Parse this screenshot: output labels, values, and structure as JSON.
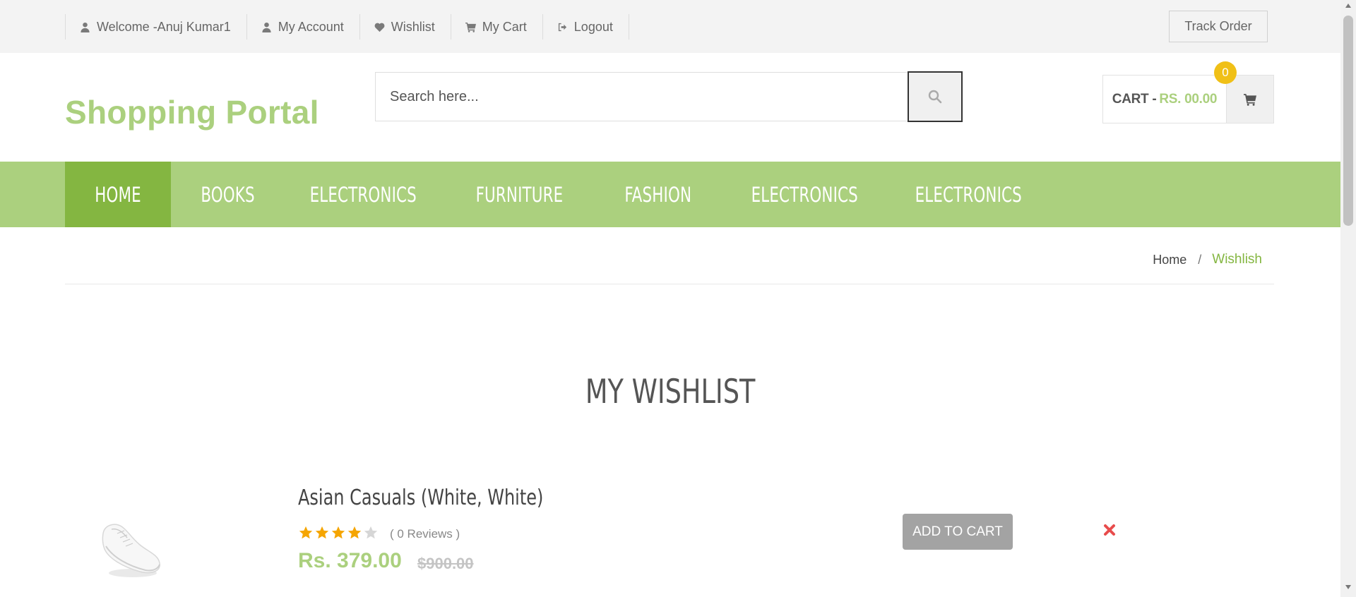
{
  "topbar": {
    "links": [
      {
        "label": "Welcome -Anuj Kumar1",
        "icon": "user-icon"
      },
      {
        "label": "My Account",
        "icon": "user-icon"
      },
      {
        "label": "Wishlist",
        "icon": "heart-icon"
      },
      {
        "label": "My Cart",
        "icon": "cart-icon"
      },
      {
        "label": "Logout",
        "icon": "sign-out-icon"
      }
    ],
    "track_order": "Track Order"
  },
  "header": {
    "logo": "Shopping Portal",
    "search_placeholder": "Search here...",
    "cart_label": "CART -",
    "cart_amount": "RS. 00.00",
    "cart_count": "0"
  },
  "nav": {
    "items": [
      "HOME",
      "BOOKS",
      "ELECTRONICS",
      "FURNITURE",
      "FASHION",
      "ELECTRONICS",
      "ELECTRONICS"
    ],
    "active": "HOME"
  },
  "breadcrumb": {
    "home": "Home",
    "separator": "/",
    "current": "Wishlish"
  },
  "wishlist": {
    "title": "MY WISHLIST",
    "items": [
      {
        "name": "Asian Casuals (White, White)",
        "rating": 4,
        "rating_max": 5,
        "reviews": "( 0 Reviews )",
        "price": "Rs. 379.00",
        "old_price": "$900.00",
        "add_to_cart": "ADD TO CART"
      }
    ]
  },
  "colors": {
    "brand_green": "#abd07e",
    "active_green": "#84b641",
    "badge_yellow": "#f0c017",
    "star_orange": "#f5a500",
    "remove_red": "#e84c4c"
  }
}
